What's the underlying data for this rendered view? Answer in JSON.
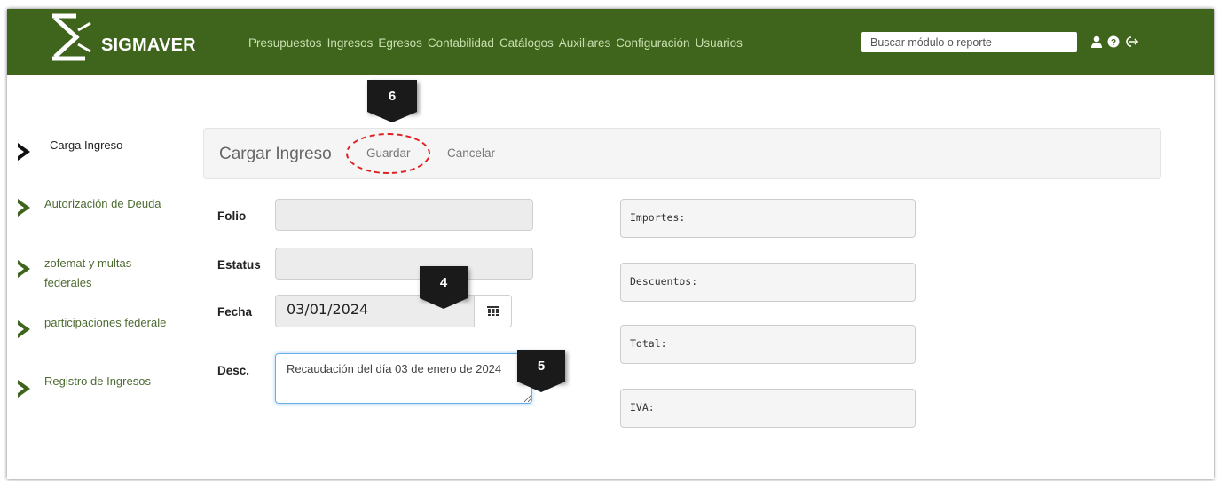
{
  "app": {
    "brand": "SIGMAVER",
    "menu": [
      "Presupuestos",
      "Ingresos",
      "Egresos",
      "Contabilidad",
      "Catálogos",
      "Auxiliares",
      "Configuración",
      "Usuarios"
    ],
    "search_placeholder": "Buscar módulo o reporte",
    "icons": [
      "user-icon",
      "help-icon",
      "logout-icon"
    ]
  },
  "sidebar": {
    "items": [
      {
        "label": "Carga Ingreso",
        "active": true
      },
      {
        "label": "Autorización de Deuda",
        "active": false
      },
      {
        "label": "zofemat y multas federales",
        "active": false
      },
      {
        "label": "participaciones federale",
        "active": false
      },
      {
        "label": "Registro de Ingresos",
        "active": false
      }
    ]
  },
  "toolbar": {
    "title": "Cargar Ingreso",
    "save_label": "Guardar",
    "cancel_label": "Cancelar"
  },
  "form": {
    "folio_label": "Folio",
    "folio_value": "",
    "status_label": "Estatus",
    "status_value": "",
    "date_label": "Fecha",
    "date_value": "03/01/2024",
    "desc_label": "Desc.",
    "desc_value": "Recaudación del día 03 de enero de 2024"
  },
  "summary": {
    "importes": "Importes:",
    "descuentos": "Descuentos:",
    "total": "Total:",
    "iva": "IVA:"
  },
  "callouts": [
    "6",
    "4",
    "5"
  ],
  "colors": {
    "navbar": "#3f651c",
    "sidebar_link": "#4e6b33",
    "highlight": "#e02020",
    "callout": "#1a1a1a"
  }
}
